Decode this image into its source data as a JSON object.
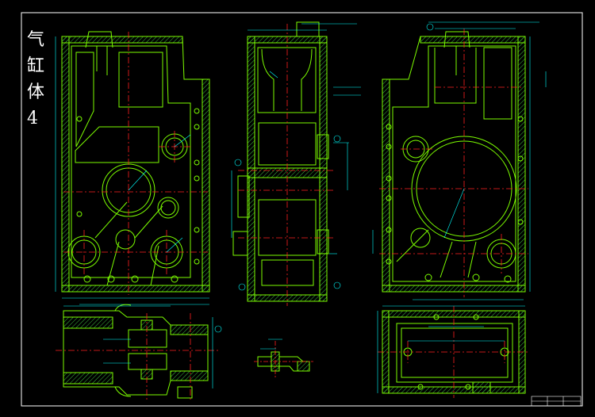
{
  "drawing": {
    "title_chars": [
      "气",
      "缸",
      "体",
      "4"
    ],
    "background": "#000000",
    "colors": {
      "outline": "#7CFC00",
      "hatch": "#3fbf3f",
      "centerline": "#ff2020",
      "dimension": "#00ffff",
      "border": "#ffffff",
      "annotation": "#ffff00"
    }
  }
}
